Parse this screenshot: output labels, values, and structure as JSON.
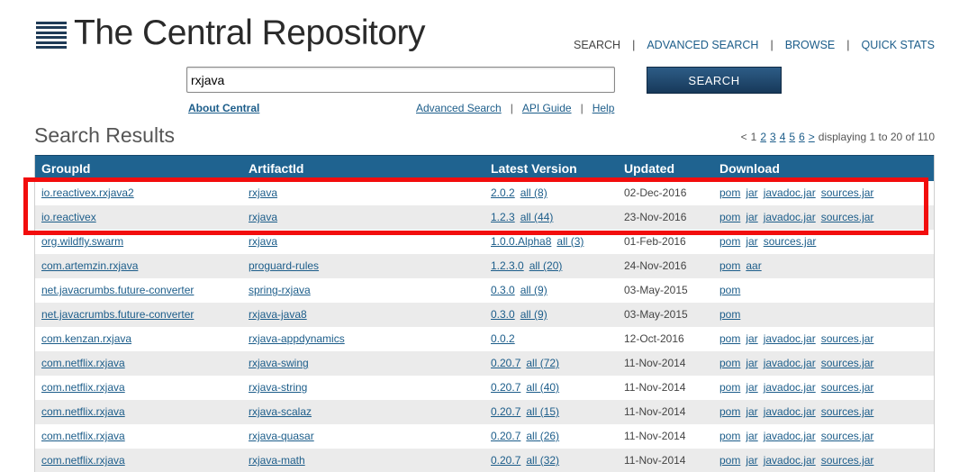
{
  "logo": {
    "title": "The Central Repository"
  },
  "topnav": [
    {
      "label": "SEARCH",
      "current": true
    },
    {
      "label": "ADVANCED SEARCH"
    },
    {
      "label": "BROWSE"
    },
    {
      "label": "QUICK STATS"
    }
  ],
  "search": {
    "value": "rxjava",
    "button_label": "SEARCH"
  },
  "links": {
    "about": "About Central",
    "advanced": "Advanced Search",
    "api": "API Guide",
    "help": "Help"
  },
  "results": {
    "title": "Search Results",
    "pager": {
      "prev": "<",
      "current": "1",
      "pages": [
        "2",
        "3",
        "4",
        "5",
        "6"
      ],
      "next": ">",
      "displaying": "displaying 1 to 20 of 110"
    },
    "columns": [
      "GroupId",
      "ArtifactId",
      "Latest Version",
      "Updated",
      "Download"
    ],
    "rows": [
      {
        "group": "io.reactivex.rxjava2",
        "artifact": "rxjava",
        "version": "2.0.2",
        "all": "all (8)",
        "updated": "02-Dec-2016",
        "downloads": [
          "pom",
          "jar",
          "javadoc.jar",
          "sources.jar"
        ]
      },
      {
        "group": "io.reactivex",
        "artifact": "rxjava",
        "version": "1.2.3",
        "all": "all (44)",
        "updated": "23-Nov-2016",
        "downloads": [
          "pom",
          "jar",
          "javadoc.jar",
          "sources.jar"
        ]
      },
      {
        "group": "org.wildfly.swarm",
        "artifact": "rxjava",
        "version": "1.0.0.Alpha8",
        "all": "all (3)",
        "updated": "01-Feb-2016",
        "downloads": [
          "pom",
          "jar",
          "sources.jar"
        ]
      },
      {
        "group": "com.artemzin.rxjava",
        "artifact": "proguard-rules",
        "version": "1.2.3.0",
        "all": "all (20)",
        "updated": "24-Nov-2016",
        "downloads": [
          "pom",
          "aar"
        ]
      },
      {
        "group": "net.javacrumbs.future-converter",
        "artifact": "spring-rxjava",
        "version": "0.3.0",
        "all": "all (9)",
        "updated": "03-May-2015",
        "downloads": [
          "pom"
        ]
      },
      {
        "group": "net.javacrumbs.future-converter",
        "artifact": "rxjava-java8",
        "version": "0.3.0",
        "all": "all (9)",
        "updated": "03-May-2015",
        "downloads": [
          "pom"
        ]
      },
      {
        "group": "com.kenzan.rxjava",
        "artifact": "rxjava-appdynamics",
        "version": "0.0.2",
        "all": "",
        "updated": "12-Oct-2016",
        "downloads": [
          "pom",
          "jar",
          "javadoc.jar",
          "sources.jar"
        ]
      },
      {
        "group": "com.netflix.rxjava",
        "artifact": "rxjava-swing",
        "version": "0.20.7",
        "all": "all (72)",
        "updated": "11-Nov-2014",
        "downloads": [
          "pom",
          "jar",
          "javadoc.jar",
          "sources.jar"
        ]
      },
      {
        "group": "com.netflix.rxjava",
        "artifact": "rxjava-string",
        "version": "0.20.7",
        "all": "all (40)",
        "updated": "11-Nov-2014",
        "downloads": [
          "pom",
          "jar",
          "javadoc.jar",
          "sources.jar"
        ]
      },
      {
        "group": "com.netflix.rxjava",
        "artifact": "rxjava-scalaz",
        "version": "0.20.7",
        "all": "all (15)",
        "updated": "11-Nov-2014",
        "downloads": [
          "pom",
          "jar",
          "javadoc.jar",
          "sources.jar"
        ]
      },
      {
        "group": "com.netflix.rxjava",
        "artifact": "rxjava-quasar",
        "version": "0.20.7",
        "all": "all (26)",
        "updated": "11-Nov-2014",
        "downloads": [
          "pom",
          "jar",
          "javadoc.jar",
          "sources.jar"
        ]
      },
      {
        "group": "com.netflix.rxjava",
        "artifact": "rxjava-math",
        "version": "0.20.7",
        "all": "all (32)",
        "updated": "11-Nov-2014",
        "downloads": [
          "pom",
          "jar",
          "javadoc.jar",
          "sources.jar"
        ]
      }
    ]
  },
  "colors": {
    "header_bg": "#1f6390",
    "link": "#1c5d8a",
    "highlight": "#f20d0d",
    "button": "#17395a"
  }
}
